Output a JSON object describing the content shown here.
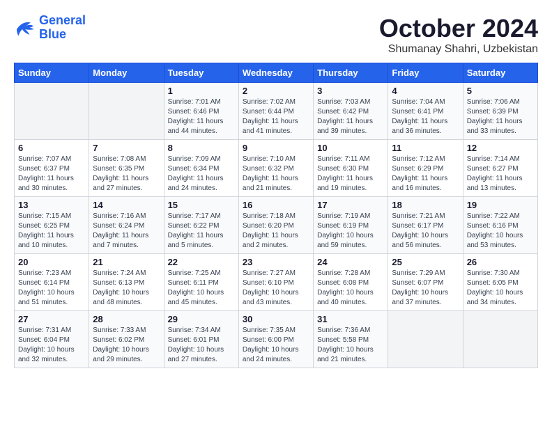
{
  "logo": {
    "line1": "General",
    "line2": "Blue"
  },
  "title": "October 2024",
  "subtitle": "Shumanay Shahri, Uzbekistan",
  "days_header": [
    "Sunday",
    "Monday",
    "Tuesday",
    "Wednesday",
    "Thursday",
    "Friday",
    "Saturday"
  ],
  "weeks": [
    [
      {
        "num": "",
        "sunrise": "",
        "sunset": "",
        "daylight": ""
      },
      {
        "num": "",
        "sunrise": "",
        "sunset": "",
        "daylight": ""
      },
      {
        "num": "1",
        "sunrise": "Sunrise: 7:01 AM",
        "sunset": "Sunset: 6:46 PM",
        "daylight": "Daylight: 11 hours and 44 minutes."
      },
      {
        "num": "2",
        "sunrise": "Sunrise: 7:02 AM",
        "sunset": "Sunset: 6:44 PM",
        "daylight": "Daylight: 11 hours and 41 minutes."
      },
      {
        "num": "3",
        "sunrise": "Sunrise: 7:03 AM",
        "sunset": "Sunset: 6:42 PM",
        "daylight": "Daylight: 11 hours and 39 minutes."
      },
      {
        "num": "4",
        "sunrise": "Sunrise: 7:04 AM",
        "sunset": "Sunset: 6:41 PM",
        "daylight": "Daylight: 11 hours and 36 minutes."
      },
      {
        "num": "5",
        "sunrise": "Sunrise: 7:06 AM",
        "sunset": "Sunset: 6:39 PM",
        "daylight": "Daylight: 11 hours and 33 minutes."
      }
    ],
    [
      {
        "num": "6",
        "sunrise": "Sunrise: 7:07 AM",
        "sunset": "Sunset: 6:37 PM",
        "daylight": "Daylight: 11 hours and 30 minutes."
      },
      {
        "num": "7",
        "sunrise": "Sunrise: 7:08 AM",
        "sunset": "Sunset: 6:35 PM",
        "daylight": "Daylight: 11 hours and 27 minutes."
      },
      {
        "num": "8",
        "sunrise": "Sunrise: 7:09 AM",
        "sunset": "Sunset: 6:34 PM",
        "daylight": "Daylight: 11 hours and 24 minutes."
      },
      {
        "num": "9",
        "sunrise": "Sunrise: 7:10 AM",
        "sunset": "Sunset: 6:32 PM",
        "daylight": "Daylight: 11 hours and 21 minutes."
      },
      {
        "num": "10",
        "sunrise": "Sunrise: 7:11 AM",
        "sunset": "Sunset: 6:30 PM",
        "daylight": "Daylight: 11 hours and 19 minutes."
      },
      {
        "num": "11",
        "sunrise": "Sunrise: 7:12 AM",
        "sunset": "Sunset: 6:29 PM",
        "daylight": "Daylight: 11 hours and 16 minutes."
      },
      {
        "num": "12",
        "sunrise": "Sunrise: 7:14 AM",
        "sunset": "Sunset: 6:27 PM",
        "daylight": "Daylight: 11 hours and 13 minutes."
      }
    ],
    [
      {
        "num": "13",
        "sunrise": "Sunrise: 7:15 AM",
        "sunset": "Sunset: 6:25 PM",
        "daylight": "Daylight: 11 hours and 10 minutes."
      },
      {
        "num": "14",
        "sunrise": "Sunrise: 7:16 AM",
        "sunset": "Sunset: 6:24 PM",
        "daylight": "Daylight: 11 hours and 7 minutes."
      },
      {
        "num": "15",
        "sunrise": "Sunrise: 7:17 AM",
        "sunset": "Sunset: 6:22 PM",
        "daylight": "Daylight: 11 hours and 5 minutes."
      },
      {
        "num": "16",
        "sunrise": "Sunrise: 7:18 AM",
        "sunset": "Sunset: 6:20 PM",
        "daylight": "Daylight: 11 hours and 2 minutes."
      },
      {
        "num": "17",
        "sunrise": "Sunrise: 7:19 AM",
        "sunset": "Sunset: 6:19 PM",
        "daylight": "Daylight: 10 hours and 59 minutes."
      },
      {
        "num": "18",
        "sunrise": "Sunrise: 7:21 AM",
        "sunset": "Sunset: 6:17 PM",
        "daylight": "Daylight: 10 hours and 56 minutes."
      },
      {
        "num": "19",
        "sunrise": "Sunrise: 7:22 AM",
        "sunset": "Sunset: 6:16 PM",
        "daylight": "Daylight: 10 hours and 53 minutes."
      }
    ],
    [
      {
        "num": "20",
        "sunrise": "Sunrise: 7:23 AM",
        "sunset": "Sunset: 6:14 PM",
        "daylight": "Daylight: 10 hours and 51 minutes."
      },
      {
        "num": "21",
        "sunrise": "Sunrise: 7:24 AM",
        "sunset": "Sunset: 6:13 PM",
        "daylight": "Daylight: 10 hours and 48 minutes."
      },
      {
        "num": "22",
        "sunrise": "Sunrise: 7:25 AM",
        "sunset": "Sunset: 6:11 PM",
        "daylight": "Daylight: 10 hours and 45 minutes."
      },
      {
        "num": "23",
        "sunrise": "Sunrise: 7:27 AM",
        "sunset": "Sunset: 6:10 PM",
        "daylight": "Daylight: 10 hours and 43 minutes."
      },
      {
        "num": "24",
        "sunrise": "Sunrise: 7:28 AM",
        "sunset": "Sunset: 6:08 PM",
        "daylight": "Daylight: 10 hours and 40 minutes."
      },
      {
        "num": "25",
        "sunrise": "Sunrise: 7:29 AM",
        "sunset": "Sunset: 6:07 PM",
        "daylight": "Daylight: 10 hours and 37 minutes."
      },
      {
        "num": "26",
        "sunrise": "Sunrise: 7:30 AM",
        "sunset": "Sunset: 6:05 PM",
        "daylight": "Daylight: 10 hours and 34 minutes."
      }
    ],
    [
      {
        "num": "27",
        "sunrise": "Sunrise: 7:31 AM",
        "sunset": "Sunset: 6:04 PM",
        "daylight": "Daylight: 10 hours and 32 minutes."
      },
      {
        "num": "28",
        "sunrise": "Sunrise: 7:33 AM",
        "sunset": "Sunset: 6:02 PM",
        "daylight": "Daylight: 10 hours and 29 minutes."
      },
      {
        "num": "29",
        "sunrise": "Sunrise: 7:34 AM",
        "sunset": "Sunset: 6:01 PM",
        "daylight": "Daylight: 10 hours and 27 minutes."
      },
      {
        "num": "30",
        "sunrise": "Sunrise: 7:35 AM",
        "sunset": "Sunset: 6:00 PM",
        "daylight": "Daylight: 10 hours and 24 minutes."
      },
      {
        "num": "31",
        "sunrise": "Sunrise: 7:36 AM",
        "sunset": "Sunset: 5:58 PM",
        "daylight": "Daylight: 10 hours and 21 minutes."
      },
      {
        "num": "",
        "sunrise": "",
        "sunset": "",
        "daylight": ""
      },
      {
        "num": "",
        "sunrise": "",
        "sunset": "",
        "daylight": ""
      }
    ]
  ]
}
